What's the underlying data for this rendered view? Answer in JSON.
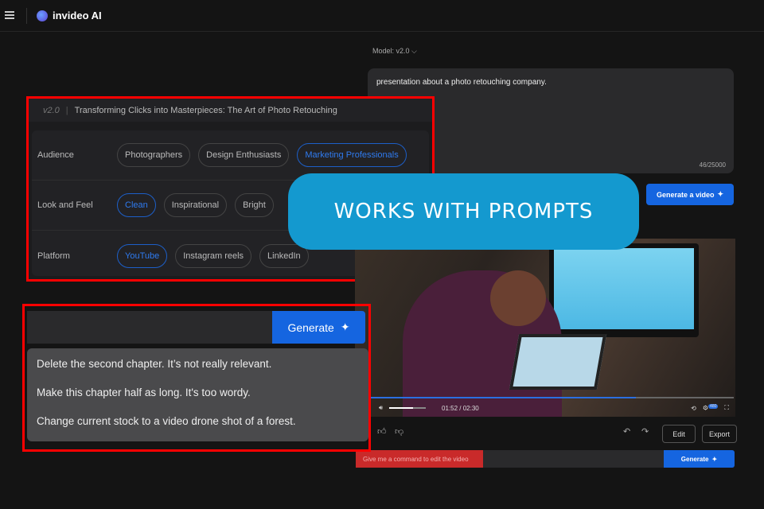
{
  "header": {
    "brand": "invideo AI"
  },
  "model": {
    "label": "Model: v2.0 ⌵"
  },
  "prompt": {
    "text": "presentation about a photo retouching company.",
    "count": "46/25000",
    "generate_label": "Generate a video"
  },
  "card": {
    "version": "v2.0",
    "title": "Transforming Clicks into Masterpieces: The Art of Photo Retouching",
    "rows": [
      {
        "label": "Audience",
        "chips": [
          "Photographers",
          "Design Enthusiasts",
          "Marketing Professionals"
        ]
      },
      {
        "label": "Look and Feel",
        "chips": [
          "Clean",
          "Inspirational",
          "Bright"
        ]
      },
      {
        "label": "Platform",
        "chips": [
          "YouTube",
          "Instagram reels",
          "LinkedIn"
        ]
      }
    ]
  },
  "banner": {
    "text": "WORKS WITH PROMPTS"
  },
  "video": {
    "time": "01:52 / 02:30",
    "progress": 0.73,
    "volume": 0.65,
    "quality": "480"
  },
  "actions": {
    "edit": "Edit",
    "export": "Export"
  },
  "command": {
    "placeholder": "Give me a command to edit the video",
    "generate": "Generate"
  },
  "edit_panel": {
    "generate": "Generate",
    "suggestions": [
      "Delete the second chapter. It’s not really relevant.",
      "Make this chapter half as long. It's too wordy.",
      "Change current stock to a video drone shot of a forest."
    ]
  }
}
